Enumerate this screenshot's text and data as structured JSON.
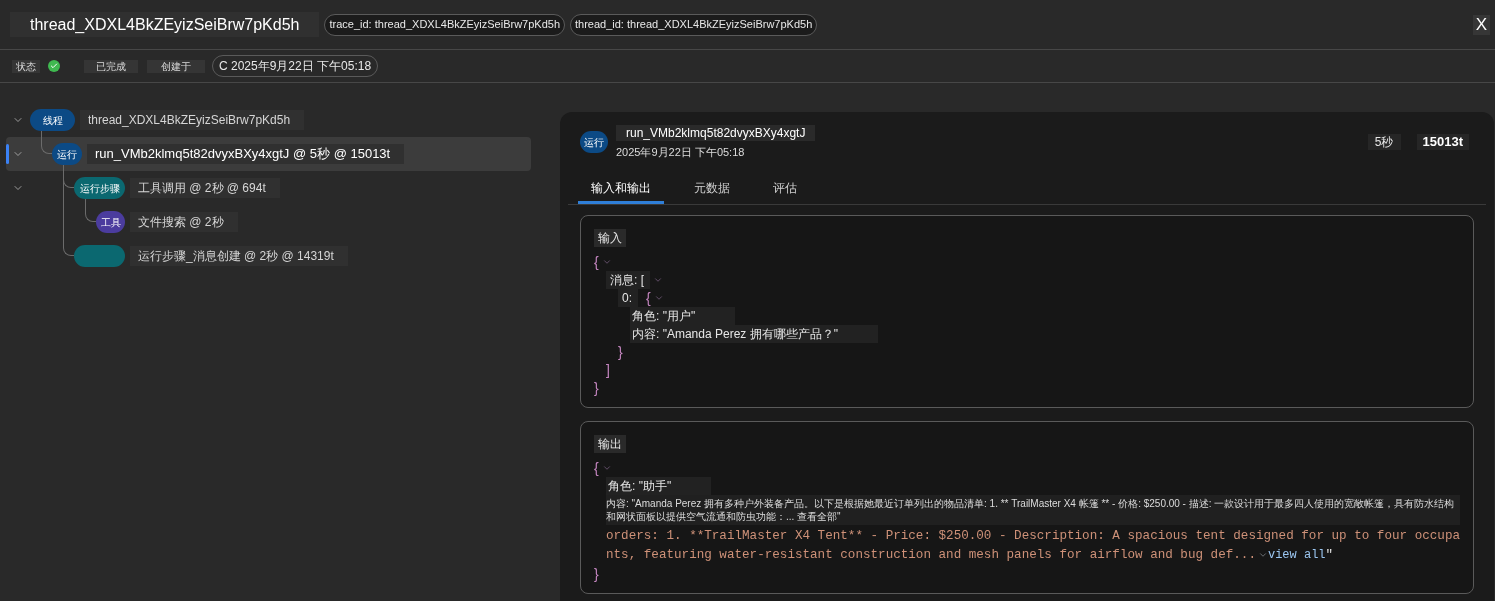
{
  "header": {
    "title": "thread_XDXL4BkZEyizSeiBrw7pKd5h",
    "ids": [
      "trace_id: thread_XDXL4BkZEyizSeiBrw7pKd5h",
      "thread_id: thread_XDXL4BkZEyizSeiBrw7pKd5h"
    ],
    "close": "X"
  },
  "status_bar": {
    "status_label": "状态",
    "status": {
      "text": "已完成",
      "completed": true
    },
    "created_label": "创建于",
    "created": "C 2025年9月22日 下午05:18"
  },
  "tree": [
    {
      "kind": "thread",
      "badge": "线程",
      "label": "thread_XDXL4BkZEyizSeiBrw7pKd5h",
      "expanded": true,
      "selected": false,
      "children": [
        {
          "kind": "run",
          "badge": "运行",
          "label": "run_VMb2klmq5t82dvyxBXy4xgtJ @ 5秒 @ 15013t",
          "expanded": true,
          "selected": true,
          "children": [
            {
              "kind": "step",
              "badge": "运行步骤",
              "label": "工具调用 @ 2秒 @ 694t",
              "expanded": true,
              "selected": false,
              "children": [
                {
                  "kind": "tool",
                  "badge": "工具",
                  "label": "文件搜索 @ 2秒",
                  "selected": false
                }
              ]
            },
            {
              "kind": "step",
              "label": "运行步骤_消息创建 @ 2秒 @ 14319t",
              "selected": false
            }
          ]
        }
      ]
    }
  ],
  "detail": {
    "kind": "run",
    "badge": "运行",
    "title": "run_VMb2klmq5t82dvyxBXy4xgtJ",
    "date": "2025年9月22日 下午05:18",
    "duration": "5秒",
    "tokens": "15013t",
    "tabs": [
      {
        "label": "输入和输出",
        "selected": true
      },
      {
        "label": "元数据",
        "selected": false
      },
      {
        "label": "评估",
        "selected": false
      }
    ],
    "input": {
      "title": "输入",
      "root": {
        "kind": "object",
        "open": "{",
        "close": "}",
        "expanded": true,
        "children": [
          {
            "kind": "object",
            "label": "消息: [",
            "close": "]",
            "expanded": true,
            "children": [
              {
                "kind": "object",
                "label": "0:",
                "open": "{",
                "close": "}",
                "expanded": true,
                "children": [
                  {
                    "kind": "field",
                    "text": "角色: \"用户\""
                  },
                  {
                    "kind": "field",
                    "text": "内容: \"Amanda Perez 拥有哪些产品？\""
                  }
                ]
              }
            ]
          }
        ]
      }
    },
    "output": {
      "title": "输出",
      "root": {
        "kind": "object",
        "open": "{",
        "close": "}",
        "expanded": true,
        "children": [
          {
            "kind": "field",
            "text": "角色: \"助手\""
          },
          {
            "kind": "note",
            "text": "内容: \"Amanda Perez 拥有多种户外装备产品。以下是根据她最近订单列出的物品清单: 1. ** TrailMaster X4 帐篷 ** - 价格: $250.00 - 描述: 一款设计用于最多四人使用的宽敞帐篷，具有防水结构和网状面板以提供空气流通和防虫功能：... 查看全部\""
          },
          {
            "kind": "code",
            "text": "orders: 1. **TrailMaster X4 Tent** - Price: $250.00 - Description: A spacious tent designed for up to four occupants, featuring water-resistant construction and mesh panels for airflow and bug def...",
            "link": "view all",
            "closing": "\""
          }
        ]
      }
    }
  }
}
